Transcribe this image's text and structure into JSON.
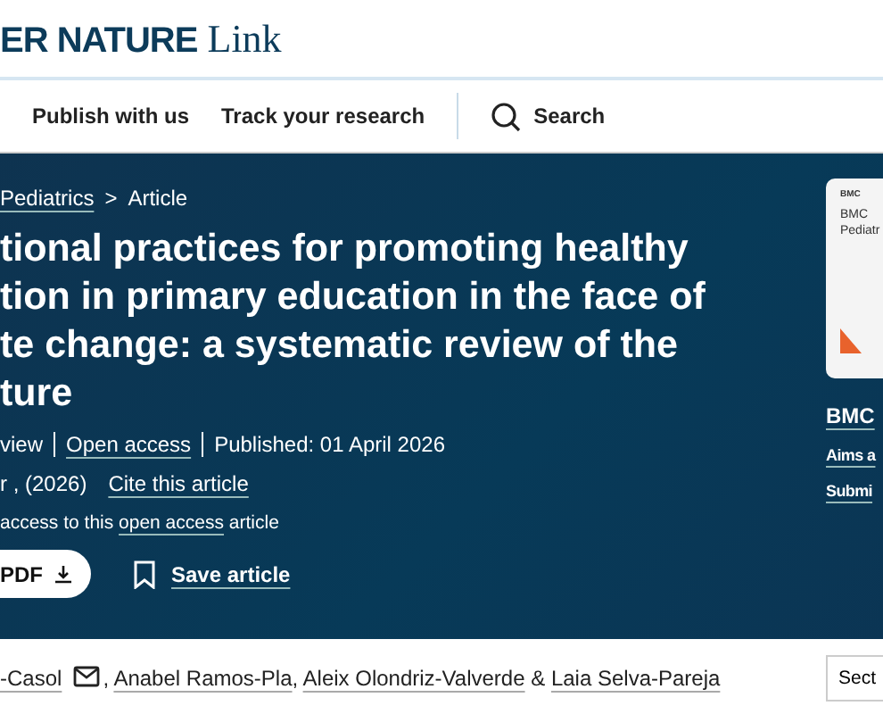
{
  "header": {
    "logo_bold": "ER NATURE",
    "logo_light": "Link"
  },
  "nav": [
    {
      "label": "Publish with us"
    },
    {
      "label": "Track your research"
    }
  ],
  "search": {
    "label": "Search"
  },
  "breadcrumb": [
    {
      "label": "Pediatrics"
    },
    {
      "label": "Article"
    }
  ],
  "breadcrumb_separator": ">",
  "title_lines": [
    "tional practices for promoting healthy",
    "tion in primary education in the face of",
    "te change: a systematic review of the",
    "ture"
  ],
  "meta": {
    "type": "view",
    "access": "Open access",
    "published": "Published: 01 April 2026",
    "citation": "r , (2026)",
    "cite_link": "Cite this article"
  },
  "access_note": {
    "before": "access to this ",
    "link": "open access",
    "after": " article"
  },
  "actions": {
    "pdf": "PDF",
    "save": "Save article"
  },
  "journal": {
    "cover_brand": "BMC",
    "cover_title": "BMC Pediatr",
    "name": "BMC",
    "links": [
      "Aims a",
      "Submi"
    ]
  },
  "authors": [
    {
      "name": "-Casol",
      "email": true,
      "sep": ","
    },
    {
      "name": "Anabel Ramos-Pla",
      "email": false,
      "sep": ","
    },
    {
      "name": "Aleix Olondriz-Valverde",
      "email": false,
      "sep": "&"
    },
    {
      "name": "Laia Selva-Pareja",
      "email": false
    }
  ],
  "sections_button": "Sect"
}
